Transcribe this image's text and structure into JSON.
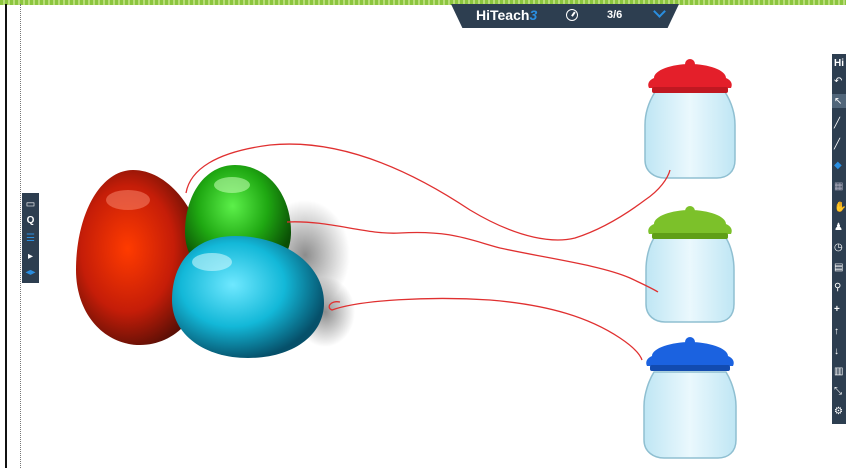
{
  "app": {
    "brand_text": "HiTeach",
    "brand_number": "3",
    "page_indicator": "3/6"
  },
  "left_toolbar": {
    "items": [
      {
        "name": "image-icon",
        "glyph": "▭"
      },
      {
        "name": "search-q-icon",
        "glyph": "Q"
      },
      {
        "name": "list-icon",
        "glyph": "☰"
      },
      {
        "name": "play-icon",
        "glyph": "▸"
      },
      {
        "name": "prev-next-icon",
        "glyph": "◂▸"
      }
    ]
  },
  "right_toolbar": {
    "title": "Hi",
    "items": [
      {
        "name": "undo-icon",
        "glyph": "↶"
      },
      {
        "name": "pointer-icon",
        "glyph": "↖"
      },
      {
        "name": "pen-icon",
        "glyph": "╱"
      },
      {
        "name": "brush-icon",
        "glyph": "╱"
      },
      {
        "name": "eraser-icon",
        "glyph": "◆"
      },
      {
        "name": "grid-icon",
        "glyph": "▦"
      },
      {
        "name": "hand-icon",
        "glyph": "✋"
      },
      {
        "name": "user-icon",
        "glyph": "♟"
      },
      {
        "name": "timer-icon",
        "glyph": "◷"
      },
      {
        "name": "ab-icon",
        "glyph": "▤"
      },
      {
        "name": "zoom-icon",
        "glyph": "⚲"
      },
      {
        "name": "plus-icon",
        "glyph": "+"
      },
      {
        "name": "up-arrow-icon",
        "glyph": "↑"
      },
      {
        "name": "down-arrow-icon",
        "glyph": "↓"
      },
      {
        "name": "trash-icon",
        "glyph": "▥"
      },
      {
        "name": "resize-icon",
        "glyph": "⤡"
      },
      {
        "name": "settings-icon",
        "glyph": "⚙"
      }
    ]
  },
  "colors": {
    "toolbar": "#2d3e50",
    "accent": "#2a8ee0",
    "strip": "#8cc63f",
    "ink": "#e03030"
  }
}
